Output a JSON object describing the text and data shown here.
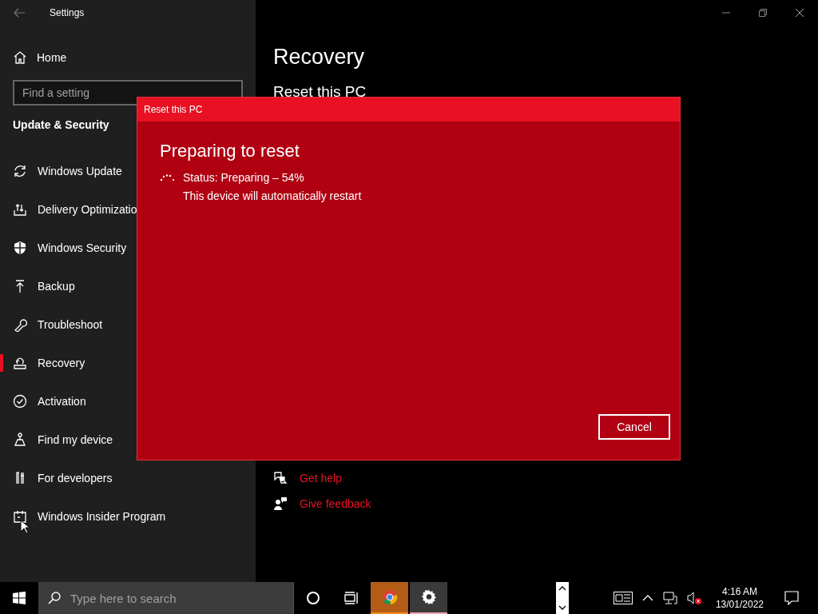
{
  "window": {
    "title": "Settings"
  },
  "sidebar": {
    "home": "Home",
    "search": {
      "placeholder": "Find a setting"
    },
    "section": "Update & Security",
    "items": [
      {
        "label": "Windows Update",
        "selected": false
      },
      {
        "label": "Delivery Optimizatio",
        "selected": false
      },
      {
        "label": "Windows Security",
        "selected": false
      },
      {
        "label": "Backup",
        "selected": false
      },
      {
        "label": "Troubleshoot",
        "selected": false
      },
      {
        "label": "Recovery",
        "selected": true
      },
      {
        "label": "Activation",
        "selected": false
      },
      {
        "label": "Find my device",
        "selected": false
      },
      {
        "label": "For developers",
        "selected": false
      },
      {
        "label": "Windows Insider Program",
        "selected": false
      }
    ]
  },
  "main": {
    "title": "Recovery",
    "subtitle": "Reset this PC",
    "links": [
      "Get help",
      "Give feedback"
    ]
  },
  "dialog": {
    "title": "Reset this PC",
    "heading": "Preparing to reset",
    "status": "Status: Preparing – 54%",
    "note": "This device will automatically restart",
    "button": "Cancel"
  },
  "taskbar": {
    "search": {
      "placeholder": "Type here to search"
    },
    "apps": [
      {
        "kind": "chrome",
        "flashing": true,
        "active": false
      },
      {
        "kind": "settings",
        "flashing": false,
        "active": true
      }
    ],
    "time": "4:16 AM",
    "date": "13/01/2022"
  }
}
